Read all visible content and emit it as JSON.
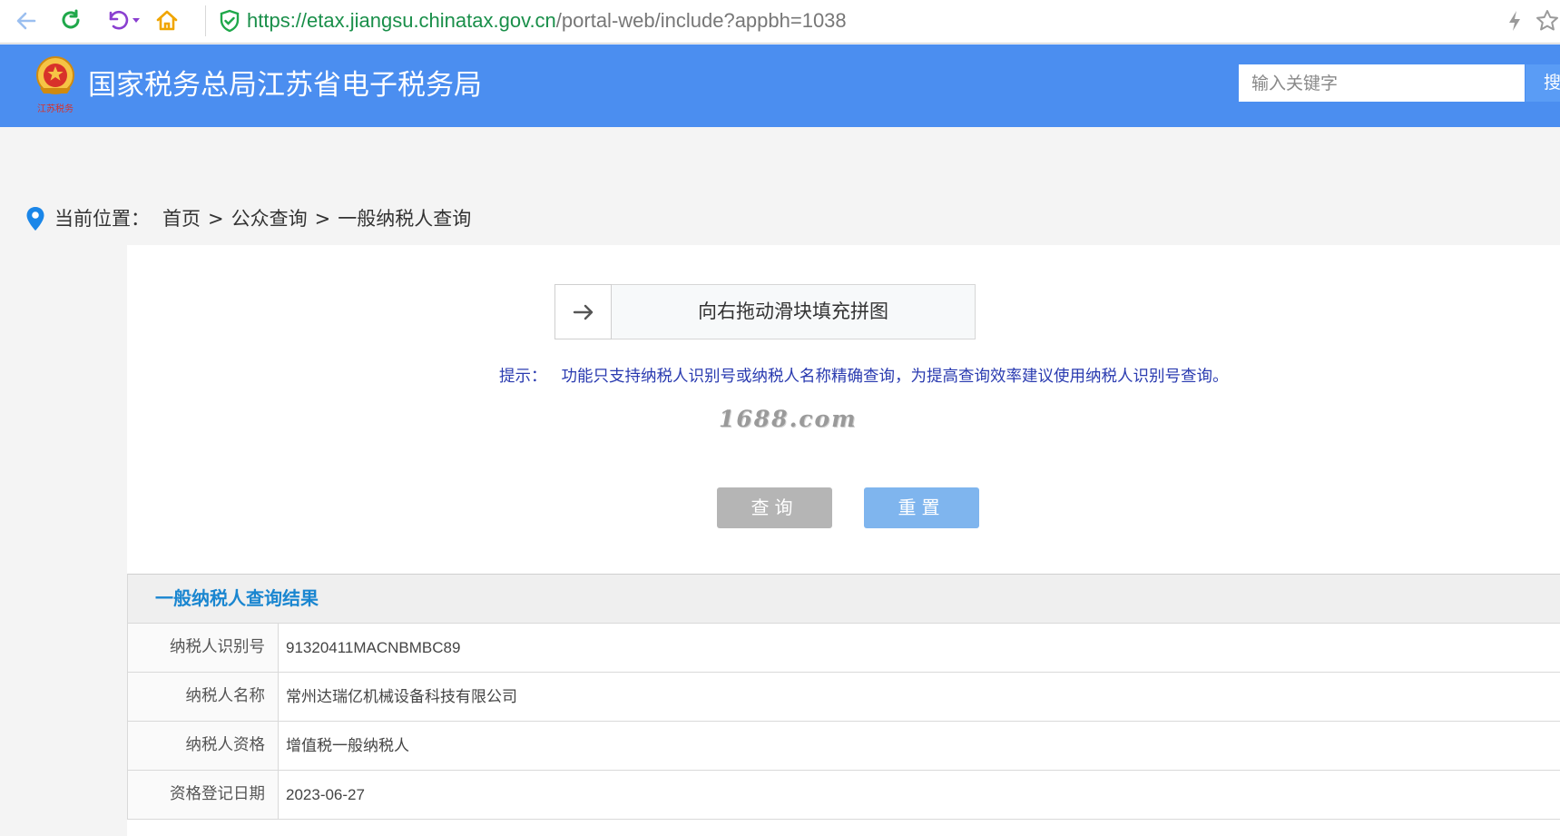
{
  "browser": {
    "url_host": "https://etax.jiangsu.chinatax.gov.cn",
    "url_path": "/portal-web/include?appbh=1038"
  },
  "header": {
    "emblem_caption": "江苏税务",
    "site_title": "国家税务总局江苏省电子税务局",
    "search_placeholder": "输入关键字",
    "search_button": "搜"
  },
  "breadcrumb": {
    "label": "当前位置：",
    "home": "首页",
    "separator": ">",
    "public_query": "公众查询",
    "current": "一般纳税人查询"
  },
  "captcha": {
    "slider_text": "向右拖动滑块填充拼图"
  },
  "tip": {
    "label": "提示：",
    "text": "功能只支持纳税人识别号或纳税人名称精确查询，为提高查询效率建议使用纳税人识别号查询。"
  },
  "watermark": "1688.com",
  "buttons": {
    "query": "查询",
    "reset": "重置"
  },
  "result": {
    "title": "一般纳税人查询结果",
    "rows": [
      {
        "label": "纳税人识别号",
        "value": "91320411MACNBMBC89"
      },
      {
        "label": "纳税人名称",
        "value": "常州达瑞亿机械设备科技有限公司"
      },
      {
        "label": "纳税人资格",
        "value": "增值税一般纳税人"
      },
      {
        "label": "资格登记日期",
        "value": "2023-06-27"
      }
    ]
  },
  "colors": {
    "header_bg": "#4b8ef0",
    "tip_text": "#2a3bb0",
    "result_title": "#1a86d0",
    "query_button": "#b5b5b5",
    "reset_button": "#7fb5ee"
  }
}
